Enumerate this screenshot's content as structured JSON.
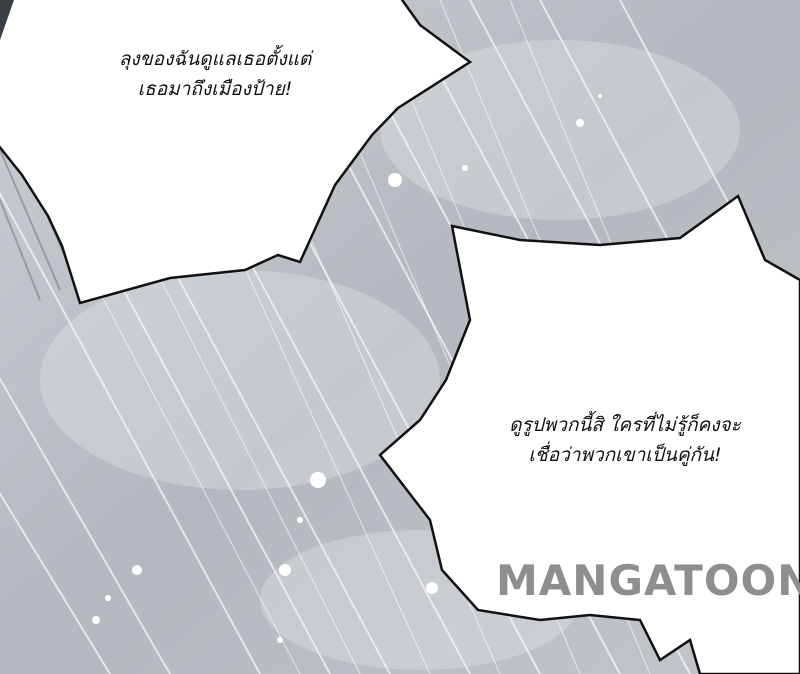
{
  "panel": {
    "bubble_top": {
      "line1": "ลุงของฉันดูแลเธอตั้งแต่",
      "line2": "เธอมาถึงเมืองป้าย!"
    },
    "bubble_right": {
      "line1": "ดูรูปพวกนี้สิ ใครที่ไม่รู้ก็คงจะ",
      "line2": "เชื่อว่าพวกเขาเป็นคู่กัน!"
    },
    "watermark": "MANGATOON"
  },
  "colors": {
    "background": "#b9bec4",
    "bubble_fill": "#ffffff",
    "bubble_outline": "#111111",
    "watermark": "#8e8e8e"
  }
}
